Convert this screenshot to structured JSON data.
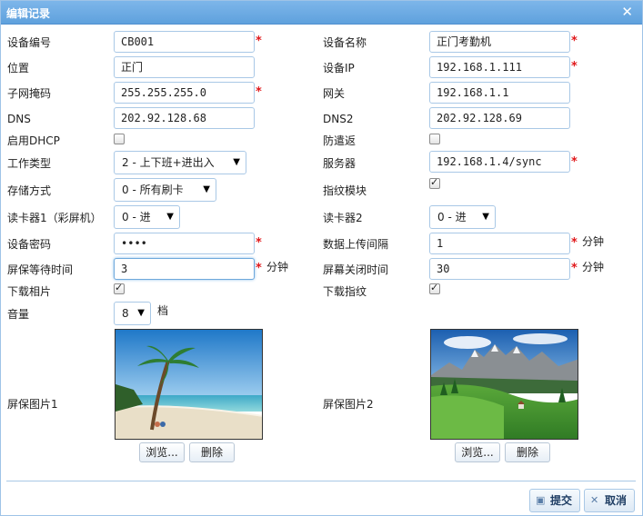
{
  "dialog": {
    "title": "编辑记录"
  },
  "fields": {
    "device_no": {
      "label": "设备编号",
      "value": "CB001"
    },
    "device_name": {
      "label": "设备名称",
      "value": "正门考勤机"
    },
    "location": {
      "label": "位置",
      "value": "正门"
    },
    "device_ip": {
      "label": "设备IP",
      "value": "192.168.1.111"
    },
    "subnet": {
      "label": "子网掩码",
      "value": "255.255.255.0"
    },
    "gateway": {
      "label": "网关",
      "value": "192.168.1.1"
    },
    "dns": {
      "label": "DNS",
      "value": "202.92.128.68"
    },
    "dns2": {
      "label": "DNS2",
      "value": "202.92.128.69"
    },
    "dhcp": {
      "label": "启用DHCP",
      "checked": false
    },
    "antipassback": {
      "label": "防遣返",
      "checked": false
    },
    "work_type": {
      "label": "工作类型",
      "value": "2 - 上下班+进出入"
    },
    "server": {
      "label": "服务器",
      "value": "192.168.1.4/sync"
    },
    "storage": {
      "label": "存储方式",
      "value": "0 - 所有刷卡"
    },
    "fingerprint_module": {
      "label": "指纹模块",
      "checked": true
    },
    "reader1": {
      "label": "读卡器1（彩屏机）",
      "value": "0 - 进"
    },
    "reader2": {
      "label": "读卡器2",
      "value": "0 - 进"
    },
    "device_password": {
      "label": "设备密码",
      "value": "••••"
    },
    "upload_interval": {
      "label": "数据上传间隔",
      "value": "1",
      "unit": "分钟"
    },
    "screensaver_wait": {
      "label": "屏保等待时间",
      "value": "3",
      "unit": "分钟"
    },
    "screen_off": {
      "label": "屏幕关闭时间",
      "value": "30",
      "unit": "分钟"
    },
    "download_photo": {
      "label": "下载相片",
      "checked": true
    },
    "download_fingerprint": {
      "label": "下载指纹",
      "checked": true
    },
    "volume": {
      "label": "音量",
      "value": "8",
      "unit": "档"
    },
    "screensaver_pic1": {
      "label": "屏保图片1"
    },
    "screensaver_pic2": {
      "label": "屏保图片2"
    }
  },
  "buttons": {
    "browse": "浏览...",
    "delete": "删除",
    "submit": "提交",
    "cancel": "取消"
  },
  "icons": {
    "close": "close-icon",
    "submit": "save-icon",
    "cancel": "cancel-icon"
  },
  "colors": {
    "titlebar": "#6aa9e2",
    "required": "#e0181b",
    "border": "#a9c8e6"
  }
}
